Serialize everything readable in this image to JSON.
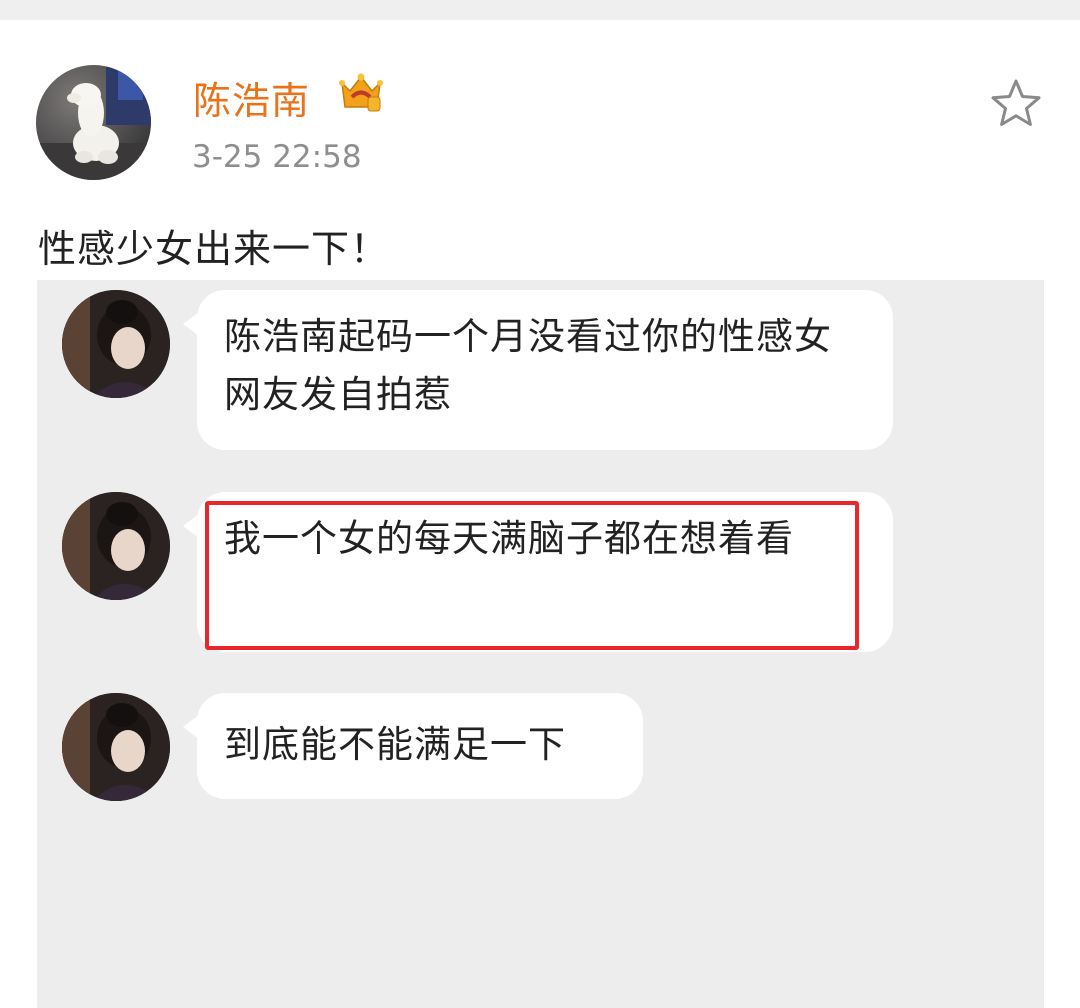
{
  "post": {
    "author": "陈浩南",
    "timestamp": "3-25 22:58",
    "text": "性感少女出来一下！",
    "badge_icon": "vip-crown-icon",
    "favorite_icon": "star-outline-icon"
  },
  "screenshot": {
    "messages": [
      {
        "text": "陈浩南起码一个月没看过你的性感女网友发自拍惹"
      },
      {
        "text": "我一个女的每天满脑子都在想着看",
        "highlighted": true
      },
      {
        "text": "到底能不能满足一下"
      }
    ]
  },
  "colors": {
    "username": "#e8731a",
    "highlight": "#e8262c",
    "panel_background": "#ededed"
  }
}
